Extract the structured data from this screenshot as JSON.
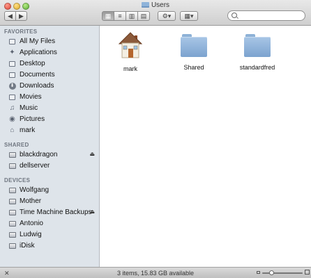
{
  "window": {
    "title": "Users"
  },
  "toolbar": {
    "back_icon": "◀",
    "forward_icon": "▶",
    "view_modes": [
      "icon-view",
      "list-view",
      "column-view",
      "coverflow-view"
    ],
    "view_glyphs": [
      "▦",
      "≡",
      "▥",
      "▤"
    ],
    "action_label": "⚙▾",
    "arrange_label": "▦▾",
    "search": {
      "value": "",
      "placeholder": ""
    }
  },
  "sidebar": {
    "favorites_header": "FAVORITES",
    "favorites": [
      {
        "label": "All My Files",
        "icon": "all-files-icon"
      },
      {
        "label": "Applications",
        "icon": "applications-icon"
      },
      {
        "label": "Desktop",
        "icon": "desktop-icon"
      },
      {
        "label": "Documents",
        "icon": "documents-icon"
      },
      {
        "label": "Downloads",
        "icon": "downloads-icon"
      },
      {
        "label": "Movies",
        "icon": "movies-icon"
      },
      {
        "label": "Music",
        "icon": "music-icon"
      },
      {
        "label": "Pictures",
        "icon": "pictures-icon"
      },
      {
        "label": "mark",
        "icon": "home-icon"
      }
    ],
    "shared_header": "SHARED",
    "shared": [
      {
        "label": "blackdragon",
        "eject": true
      },
      {
        "label": "dellserver",
        "eject": false
      }
    ],
    "devices_header": "DEVICES",
    "devices": [
      {
        "label": "Wolfgang",
        "eject": false
      },
      {
        "label": "Mother",
        "eject": false
      },
      {
        "label": "Time Machine Backups",
        "eject": true
      },
      {
        "label": "Antonio",
        "eject": false
      },
      {
        "label": "Ludwig",
        "eject": false
      },
      {
        "label": "iDisk",
        "eject": false
      }
    ]
  },
  "content": {
    "items": [
      {
        "label": "mark",
        "icon": "home-folder-icon"
      },
      {
        "label": "Shared",
        "icon": "folder-icon"
      },
      {
        "label": "standardfred",
        "icon": "folder-icon"
      }
    ]
  },
  "status": {
    "text": "3 items, 15.83 GB available"
  },
  "colors": {
    "sidebar_bg": "#dee4ea",
    "folder_blue": "#8eb2d7",
    "section_header": "#6f7680"
  }
}
